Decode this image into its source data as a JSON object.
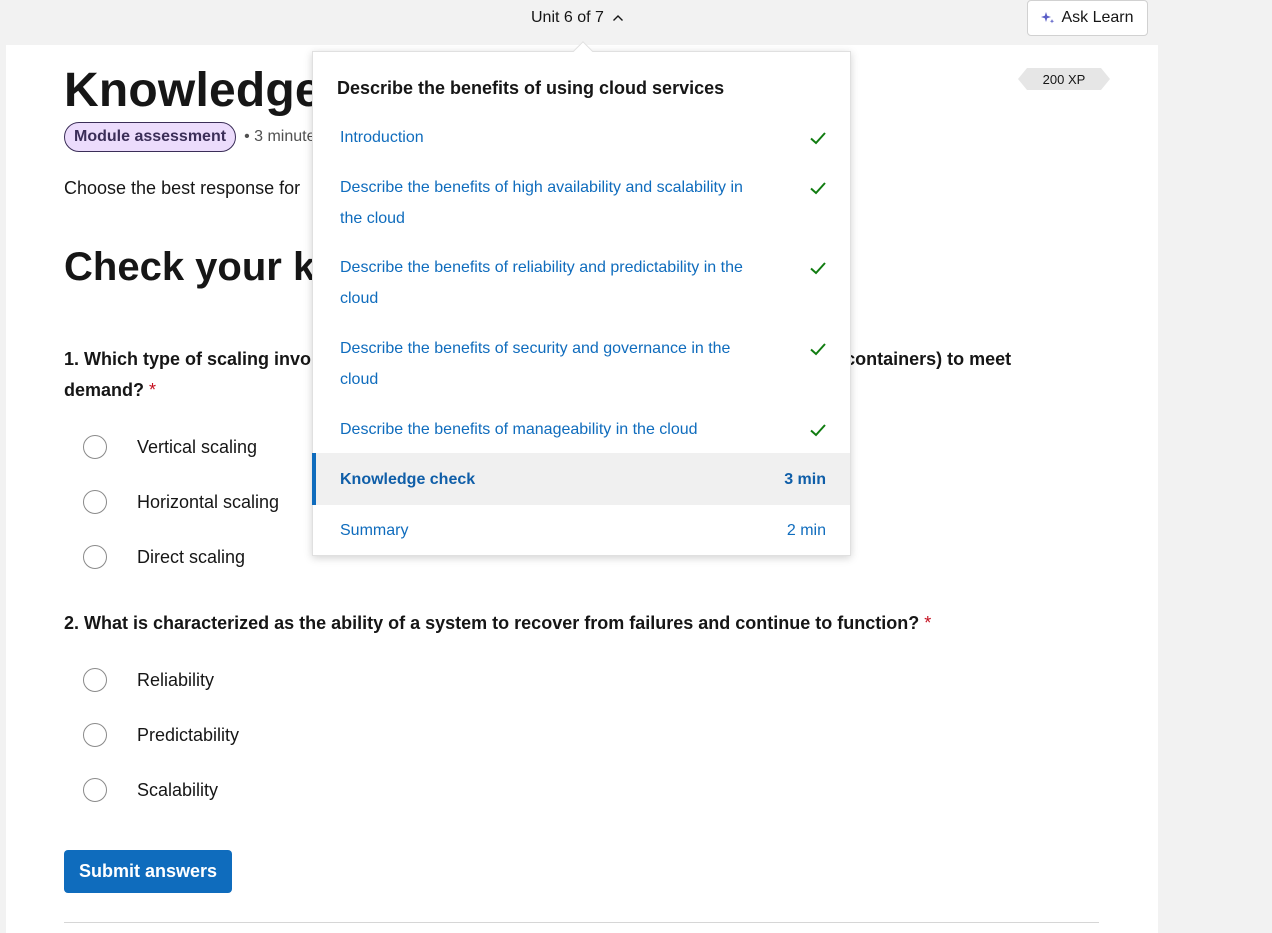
{
  "header": {
    "unit_indicator": "Unit 6 of 7",
    "ask_learn_label": "Ask Learn"
  },
  "page": {
    "title": "Knowledge",
    "xp": "200 XP",
    "module_badge": "Module assessment",
    "meta_suffix": "• 3 minute",
    "instructions": "Choose the best response for",
    "section_heading": "Check your kr"
  },
  "questions": [
    {
      "number": "1.",
      "text_start": "Which type of scaling invo",
      "text_end": "r containers) to meet demand?",
      "required_mark": "*",
      "options": [
        "Vertical scaling",
        "Horizontal scaling",
        "Direct scaling"
      ]
    },
    {
      "number": "2.",
      "text": "What is characterized as the ability of a system to recover from failures and continue to function?",
      "required_mark": "*",
      "options": [
        "Reliability",
        "Predictability",
        "Scalability"
      ]
    }
  ],
  "submit_label": "Submit answers",
  "unit_panel": {
    "title": "Describe the benefits of using cloud services",
    "units": [
      {
        "label": "Introduction",
        "status": "complete"
      },
      {
        "label": "Describe the benefits of high availability and scalability in the cloud",
        "status": "complete"
      },
      {
        "label": "Describe the benefits of reliability and predictability in the cloud",
        "status": "complete"
      },
      {
        "label": "Describe the benefits of security and governance in the cloud",
        "status": "complete"
      },
      {
        "label": "Describe the benefits of manageability in the cloud",
        "status": "complete"
      },
      {
        "label": "Knowledge check",
        "status": "current",
        "duration": "3 min"
      },
      {
        "label": "Summary",
        "status": "not-started",
        "duration": "2 min"
      }
    ]
  },
  "icons": {
    "chevron": "chevron-up-icon",
    "ask_learn": "sparkle-icon",
    "complete": "checkmark-icon"
  },
  "colors": {
    "accent": "#0f6cbd",
    "check_green": "#107c10",
    "badge_bg": "#ecdcfc",
    "required_red": "#c50f1f"
  }
}
